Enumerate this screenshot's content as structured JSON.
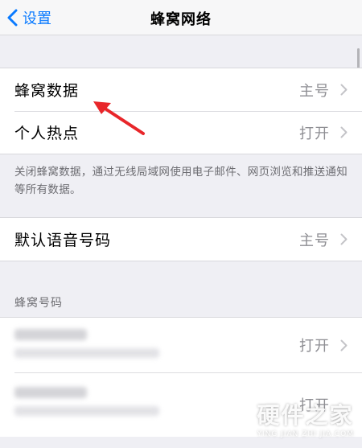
{
  "navbar": {
    "back_label": "设置",
    "title": "蜂窝网络"
  },
  "group1": {
    "rows": [
      {
        "label": "蜂窝数据",
        "value": "主号"
      },
      {
        "label": "个人热点",
        "value": "打开"
      }
    ]
  },
  "footnote": "关闭蜂窝数据，通过无线局域网使用电子邮件、网页浏览和推送通知等所有数据。",
  "group2": {
    "rows": [
      {
        "label": "默认语音号码",
        "value": "主号"
      }
    ]
  },
  "section_header": "蜂窝号码",
  "group3": {
    "rows": [
      {
        "value": "打开"
      },
      {
        "value": "打开"
      }
    ]
  },
  "watermark": {
    "main": "硬件之家",
    "sub": "YING JIAN ZHI JIA.COM"
  },
  "colors": {
    "accent": "#0a7aff",
    "annotation_arrow": "#e8262a",
    "background": "#efeff4"
  },
  "icons": {
    "back": "chevron-left-icon",
    "disclosure": "chevron-right-icon",
    "annotation": "red-arrow-icon",
    "watermark_logo": "hexagon-logo-icon"
  }
}
